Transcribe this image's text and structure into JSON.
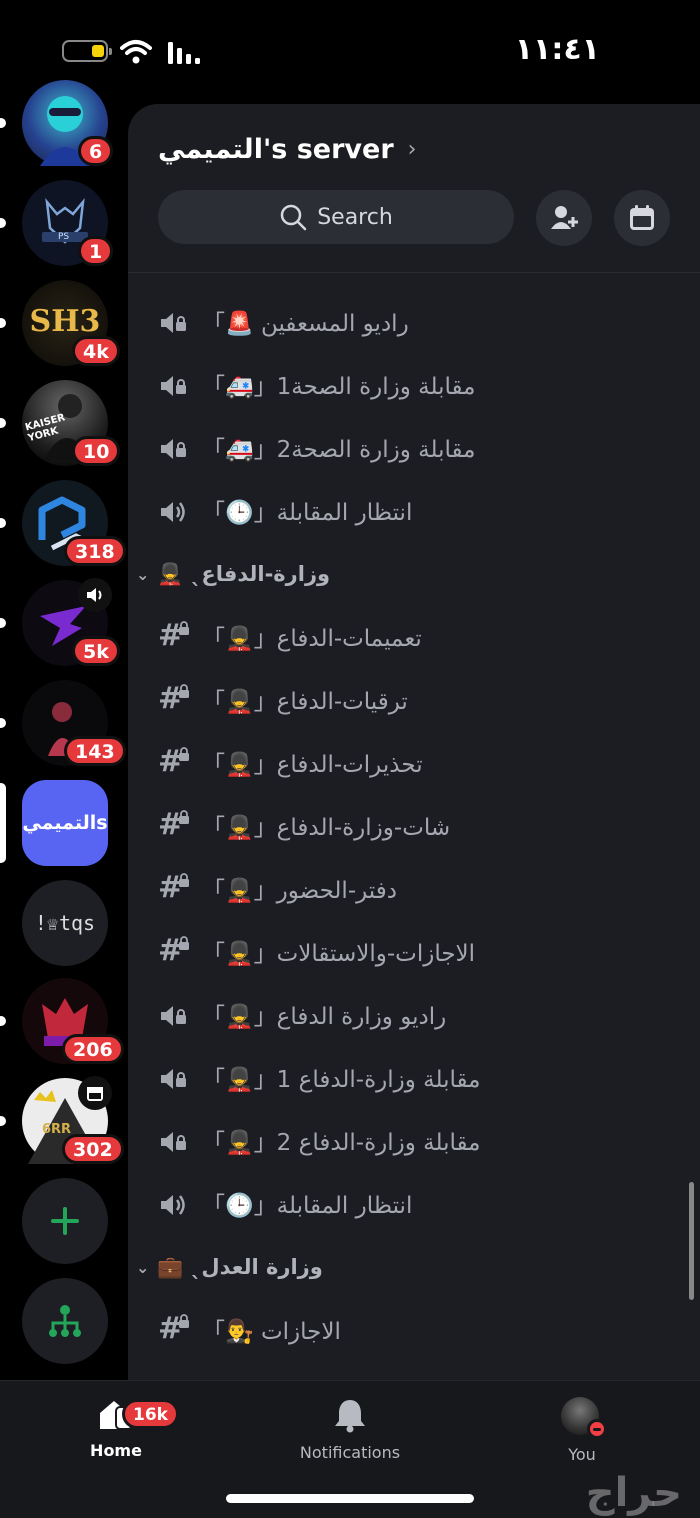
{
  "status_bar": {
    "time": "١١:٤١"
  },
  "servers": [
    {
      "id": "s1",
      "badge": "6"
    },
    {
      "id": "s2",
      "label": "PS",
      "badge": "1"
    },
    {
      "id": "s3",
      "label": "SH3",
      "badge": "4k"
    },
    {
      "id": "s4",
      "label": "KAISER YORK",
      "badge": "10"
    },
    {
      "id": "s5",
      "badge": "318"
    },
    {
      "id": "s6",
      "badge": "5k"
    },
    {
      "id": "s7",
      "badge": "143"
    },
    {
      "id": "s8",
      "label": "التميميs"
    },
    {
      "id": "s9",
      "label": "!♕tqs"
    },
    {
      "id": "s10",
      "badge": "206"
    },
    {
      "id": "s11",
      "label": "6RR",
      "badge": "302"
    }
  ],
  "channel_panel": {
    "server_name": "التميمي's server",
    "search_placeholder": "Search",
    "channels": [
      {
        "type": "voice-locked",
        "name": "「🚨 راديو المسعفين"
      },
      {
        "type": "voice-locked",
        "name": "「🚑」1مقابلة وزارة الصحة"
      },
      {
        "type": "voice-locked",
        "name": "「🚑」2مقابلة وزارة الصحة"
      },
      {
        "type": "voice",
        "name": "「🕒」انتظار المقابلة"
      },
      {
        "type": "category",
        "name": "💂‍♂️ ˎوزارة-الدفاع"
      },
      {
        "type": "text-locked",
        "name": "「💂‍♂️」تعميمات-الدفاع"
      },
      {
        "type": "text-locked",
        "name": "「💂‍♂️」ترقيات-الدفاع"
      },
      {
        "type": "text-locked",
        "name": "「💂‍♂️」تحذيرات-الدفاع"
      },
      {
        "type": "text-locked",
        "name": "「💂‍♂️」شات-وزارة-الدفاع"
      },
      {
        "type": "text-locked",
        "name": "「💂‍♂️」دفتر-الحضور"
      },
      {
        "type": "text-locked",
        "name": "「💂‍♂️」الاجازات-والاستقالات"
      },
      {
        "type": "voice-locked",
        "name": "「💂‍♂️」راديو وزارة الدفاع"
      },
      {
        "type": "voice-locked",
        "name": "「💂‍♂️」1 مقابلة وزارة-الدفاع"
      },
      {
        "type": "voice-locked",
        "name": "「💂‍♂️」2 مقابلة وزارة-الدفاع"
      },
      {
        "type": "voice",
        "name": "「🕒」انتظار المقابلة"
      },
      {
        "type": "category",
        "name": "💼 ˎوزارة العدل"
      },
      {
        "type": "text-locked",
        "name": "「👨‍⚖️ الاجازات"
      }
    ]
  },
  "bottom_nav": {
    "home_label": "Home",
    "home_badge": "16k",
    "notifications_label": "Notifications",
    "you_label": "You"
  },
  "watermark": "حراج",
  "colors": {
    "badge": "#e5393c",
    "selected_server": "#5865f2",
    "panel_bg": "#1c1d22",
    "add_green": "#23a55a"
  }
}
